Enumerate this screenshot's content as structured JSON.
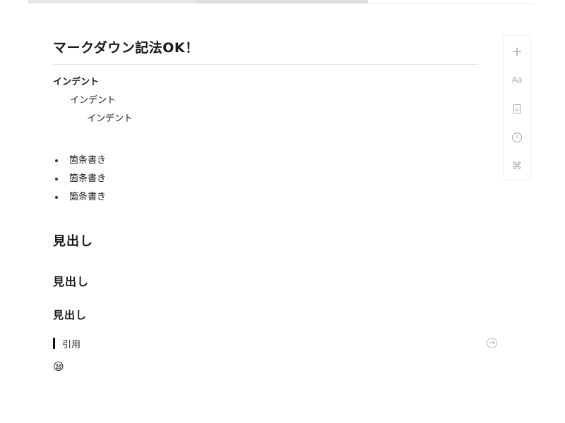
{
  "document": {
    "title": "マークダウン記法OK！",
    "indents": [
      "インデント",
      "インデント",
      "インデント"
    ],
    "bullets": [
      "箇条書き",
      "箇条書き",
      "箇条書き"
    ],
    "headings": [
      "見出し",
      "見出し",
      "見出し"
    ],
    "quote": "引用",
    "emoji": "😪"
  },
  "toolbar": {
    "add_glyph": "+",
    "text_style_label": "Aa",
    "info_glyph": "i",
    "command_glyph": "⌘"
  },
  "icons": {
    "add": "plus-icon",
    "text_style": "text-style-icon",
    "document": "document-icon",
    "info": "info-icon",
    "command": "command-icon",
    "goto": "arrow-right-circle-icon"
  },
  "goto_glyph": "→"
}
